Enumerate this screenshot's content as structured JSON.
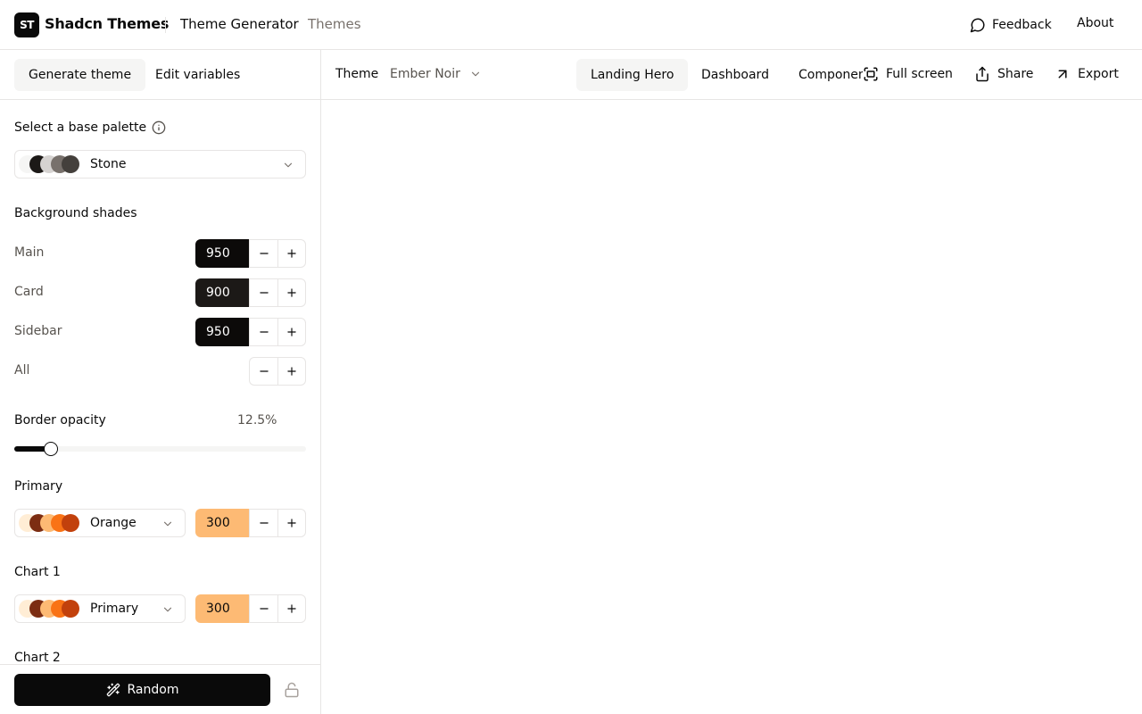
{
  "header": {
    "logo_text": "ST",
    "brand": "Shadcn Themes",
    "nav": [
      {
        "label": "Theme Generator"
      },
      {
        "label": "Themes"
      }
    ],
    "feedback": "Feedback",
    "about": "About"
  },
  "sidebar": {
    "tabs": [
      {
        "label": "Generate theme"
      },
      {
        "label": "Edit variables"
      }
    ],
    "base_palette": {
      "label": "Select a base palette",
      "value": "Stone",
      "swatches": [
        "#f5f5f4",
        "#1c1917",
        "#d6d3d1",
        "#78716c",
        "#44403c"
      ]
    },
    "background": {
      "label": "Background shades",
      "rows": [
        {
          "label": "Main",
          "value": "950",
          "bg": "#0c0a09",
          "fg": "#ffffff"
        },
        {
          "label": "Card",
          "value": "900",
          "bg": "#1c1917",
          "fg": "#ffffff"
        },
        {
          "label": "Sidebar",
          "value": "950",
          "bg": "#0c0a09",
          "fg": "#ffffff"
        },
        {
          "label": "All",
          "value": ""
        }
      ]
    },
    "border_opacity": {
      "label": "Border opacity",
      "value_text": "12.5%",
      "value": 12.5
    },
    "primary": {
      "label": "Primary",
      "palette": "Orange",
      "shade": "300",
      "shade_bg": "#fdba74",
      "swatches": [
        "#ffedd5",
        "#7c2d12",
        "#fdba74",
        "#f97316",
        "#c2410c"
      ]
    },
    "chart1": {
      "label": "Chart 1",
      "palette": "Primary",
      "shade": "300",
      "shade_bg": "#fdba74",
      "swatches": [
        "#ffedd5",
        "#7c2d12",
        "#fdba74",
        "#f97316",
        "#c2410c"
      ]
    },
    "chart2": {
      "label": "Chart 2"
    },
    "random_label": "Random"
  },
  "main": {
    "theme_label": "Theme",
    "theme_value": "Ember Noir",
    "tabs": [
      {
        "label": "Landing Hero"
      },
      {
        "label": "Dashboard"
      },
      {
        "label": "Components"
      }
    ],
    "actions": [
      {
        "label": "Full screen"
      },
      {
        "label": "Share"
      },
      {
        "label": "Export"
      }
    ]
  }
}
